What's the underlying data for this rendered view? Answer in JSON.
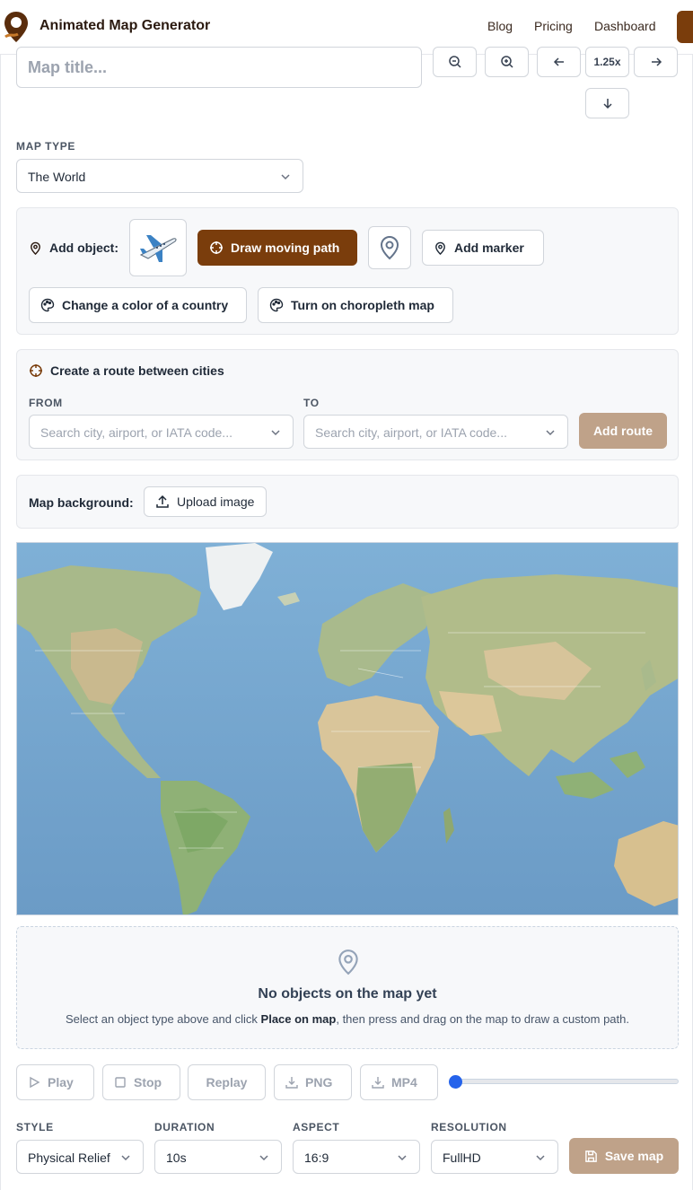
{
  "header": {
    "brand": "Animated Map Generator",
    "nav": [
      "Blog",
      "Pricing",
      "Dashboard"
    ],
    "accent": "#7a3d0c"
  },
  "title_input": {
    "placeholder": "Map title...",
    "value": ""
  },
  "zoom_controls": {
    "zoom_level": "1.25x"
  },
  "map_type": {
    "label": "MAP TYPE",
    "value": "The World"
  },
  "add_object": {
    "label": "Add object:",
    "plane_icon": "airplane-icon",
    "draw_path": "Draw moving path",
    "add_marker": "Add marker",
    "change_color": "Change a color of a country",
    "choropleth": "Turn on choropleth map"
  },
  "route": {
    "title": "Create a route between cities",
    "from_label": "FROM",
    "to_label": "TO",
    "from_placeholder": "Search city, airport, or IATA code...",
    "to_placeholder": "Search city, airport, or IATA code...",
    "add_button": "Add route"
  },
  "background": {
    "label": "Map background:",
    "upload": "Upload image"
  },
  "empty_state": {
    "title": "No objects on the map yet",
    "desc_before": "Select an object type above and click ",
    "desc_bold": "Place on map",
    "desc_after": ", then press and drag on the map to draw a custom path."
  },
  "playback": {
    "play": "Play",
    "stop": "Stop",
    "replay": "Replay",
    "png": "PNG",
    "mp4": "MP4",
    "progress": 0
  },
  "settings": {
    "style_label": "STYLE",
    "style_value": "Physical Relief",
    "duration_label": "DURATION",
    "duration_value": "10s",
    "aspect_label": "ASPECT",
    "aspect_value": "16:9",
    "resolution_label": "RESOLUTION",
    "resolution_value": "FullHD",
    "save": "Save map"
  }
}
